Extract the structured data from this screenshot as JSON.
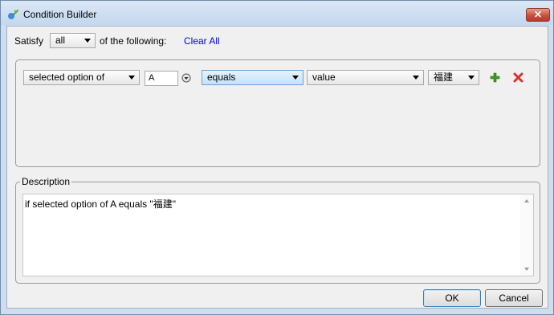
{
  "window": {
    "title": "Condition Builder",
    "close_label": "✕"
  },
  "toolbar": {
    "satisfy_label": "Satisfy",
    "match_mode": "all",
    "of_following_label": "of the following:",
    "clear_all_label": "Clear All"
  },
  "condition": {
    "subject": "selected option of",
    "field_value": "A",
    "operator": "equals",
    "compare_type": "value",
    "compare_value": "福建"
  },
  "description": {
    "label": "Description",
    "text": "if selected option of A equals \"福建\""
  },
  "buttons": {
    "ok": "OK",
    "cancel": "Cancel"
  },
  "colors": {
    "add": "#3a9a1a",
    "delete": "#d9342b",
    "link": "#0000ee",
    "highlight": "#c4e2f8"
  }
}
